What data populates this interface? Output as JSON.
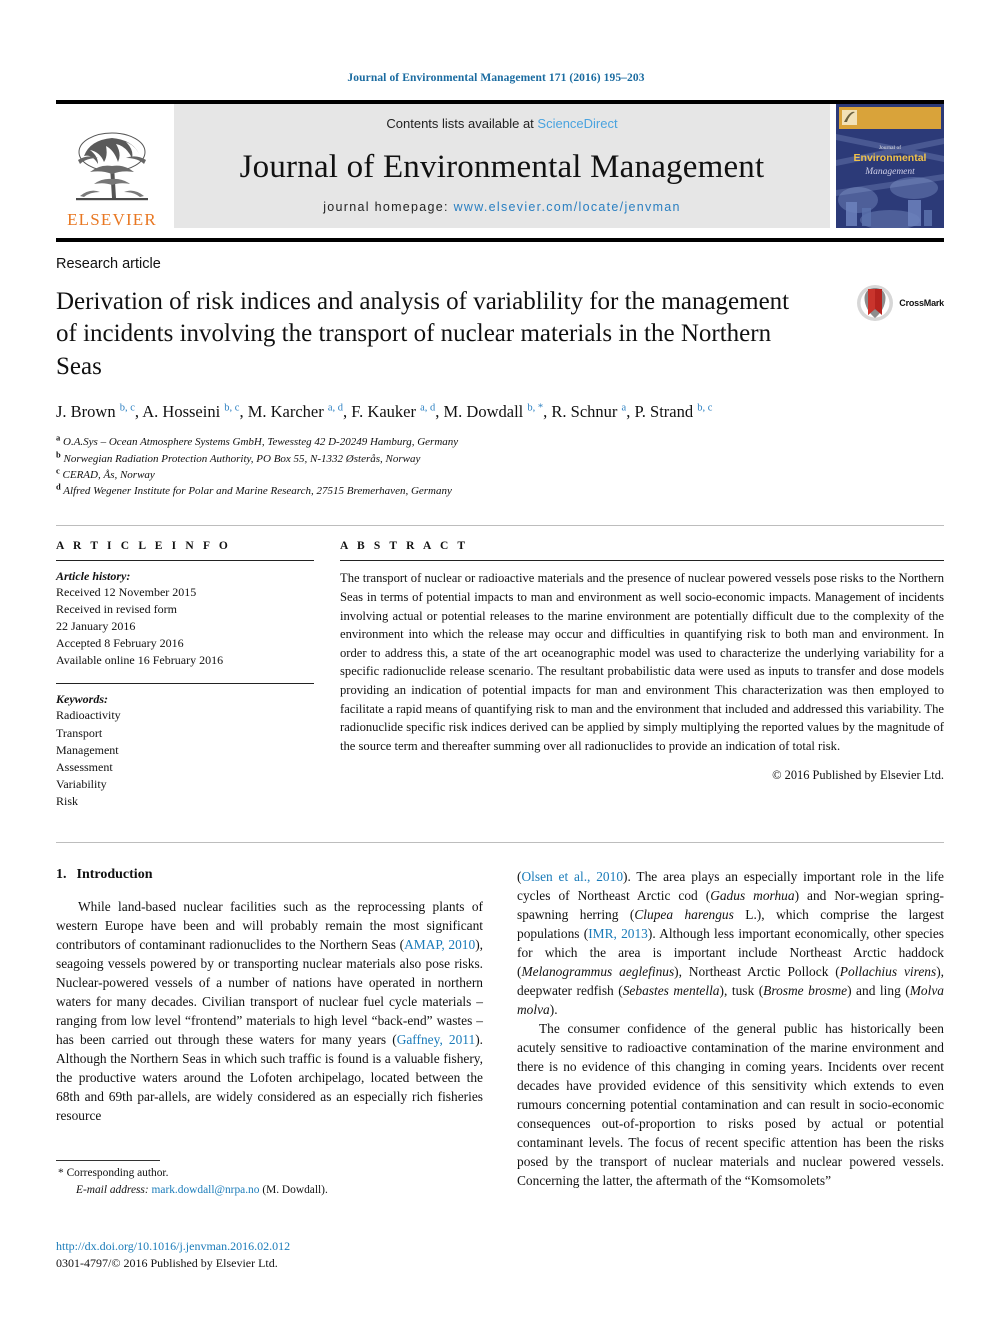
{
  "running_head": "Journal of Environmental Management 171 (2016) 195–203",
  "masthead": {
    "publisher_name": "ELSEVIER",
    "contents_prefix": "Contents lists available at ",
    "contents_link": "ScienceDirect",
    "journal_title": "Journal of Environmental Management",
    "homepage_prefix": "journal homepage: ",
    "homepage_url": "www.elsevier.com/locate/jenvman",
    "cover_label_small": "Journal of",
    "cover_label_line1": "Environmental",
    "cover_label_line2": "Management"
  },
  "article": {
    "type": "Research article",
    "title": "Derivation of risk indices and analysis of variablility for the management of incidents involving the transport of nuclear materials in the Northern Seas",
    "crossmark_label": "CrossMark",
    "authors": [
      {
        "name": "J. Brown",
        "marks": "b, c",
        "sep": ", "
      },
      {
        "name": "A. Hosseini",
        "marks": "b, c",
        "sep": ", "
      },
      {
        "name": "M. Karcher",
        "marks": "a, d",
        "sep": ", "
      },
      {
        "name": "F. Kauker",
        "marks": "a, d",
        "sep": ", "
      },
      {
        "name": "M. Dowdall",
        "marks": "b, *",
        "sep": ", "
      },
      {
        "name": "R. Schnur",
        "marks": "a",
        "sep": ", "
      },
      {
        "name": "P. Strand",
        "marks": "b, c",
        "sep": ""
      }
    ],
    "affiliations": [
      {
        "mark": "a",
        "text": "O.A.Sys – Ocean Atmosphere Systems GmbH, Tewessteg 42 D-20249 Hamburg, Germany"
      },
      {
        "mark": "b",
        "text": "Norwegian Radiation Protection Authority, PO Box 55, N-1332 Østerås, Norway"
      },
      {
        "mark": "c",
        "text": "CERAD, Ås, Norway"
      },
      {
        "mark": "d",
        "text": "Alfred Wegener Institute for Polar and Marine Research, 27515 Bremerhaven, Germany"
      }
    ]
  },
  "article_info": {
    "label": "A R T I C L E   I N F O",
    "history_head": "Article history:",
    "history_lines": [
      "Received 12 November 2015",
      "Received in revised form",
      "22 January 2016",
      "Accepted 8 February 2016",
      "Available online 16 February 2016"
    ],
    "keywords_head": "Keywords:",
    "keywords": [
      "Radioactivity",
      "Transport",
      "Management",
      "Assessment",
      "Variability",
      "Risk"
    ]
  },
  "abstract": {
    "label": "A B S T R A C T",
    "text": "The transport of nuclear or radioactive materials and the presence of nuclear powered vessels pose risks to the Northern Seas in terms of potential impacts to man and environment as well socio-economic impacts. Management of incidents involving actual or potential releases to the marine environment are potentially difficult due to the complexity of the environment into which the release may occur and difficulties in quantifying risk to both man and environment. In order to address this, a state of the art oceanographic model was used to characterize the underlying variability for a specific radionuclide release scenario. The resultant probabilistic data were used as inputs to transfer and dose models providing an indication of potential impacts for man and environment This characterization was then employed to facilitate a rapid means of quantifying risk to man and the environment that included and addressed this variability. The radionuclide specific risk indices derived can be applied by simply multiplying the reported values by the magnitude of the source term and thereafter summing over all radionuclides to provide an indication of total risk.",
    "copyright": "© 2016 Published by Elsevier Ltd."
  },
  "body": {
    "section_number": "1.",
    "section_title": "Introduction",
    "left_para_1": {
      "s1": "While land-based nuclear facilities such as the reprocessing plants of western Europe have been and will probably remain the most significant contributors of contaminant radionuclides to the Northern Seas (",
      "ref1": "AMAP, 2010",
      "s2": "), seagoing vessels powered by or transporting nuclear materials also pose risks. Nuclear-powered vessels of a number of nations have operated in northern waters for many decades. Civilian transport of nuclear fuel cycle materials – ranging from low level “frontend” materials to high level “back-end” wastes – has been carried out through these waters for many years (",
      "ref2": "Gaffney, 2011",
      "s3": "). Although the Northern Seas in which such traffic is found is a valuable fishery, the productive waters around the Lofoten archipelago, located between the 68th and 69th par-allels, are widely considered as an especially rich fisheries resource"
    },
    "right_para_1": {
      "s0": "(",
      "ref1": "Olsen et al., 2010",
      "s1": "). The area plays an especially important role in the life cycles of Northeast Arctic cod (",
      "it1": "Gadus morhua",
      "s2": ") and Nor-wegian spring-spawning herring (",
      "it2": "Clupea harengus",
      "s3": " L.), which comprise the largest populations (",
      "ref2": "IMR, 2013",
      "s4": "). Although less important economically, other species for which the area is important include Northeast Arctic haddock (",
      "it3": "Melanogrammus aeglefinus",
      "s5": "), Northeast Arctic Pollock (",
      "it4": "Pollachius virens",
      "s6": "), deepwater redfish (",
      "it5": "Sebastes mentella",
      "s7": "), tusk (",
      "it6": "Brosme brosme",
      "s8": ") and ling (",
      "it7": "Molva molva",
      "s9": ")."
    },
    "right_para_2": "The consumer confidence of the general public has historically been acutely sensitive to radioactive contamination of the marine environment and there is no evidence of this changing in coming years. Incidents over recent decades have provided evidence of this sensitivity which extends to even rumours concerning potential contamination and can result in socio-economic consequences out-of-proportion to risks posed by actual or potential contaminant levels. The focus of recent specific attention has been the risks posed by the transport of nuclear materials and nuclear powered vessels. Concerning the latter, the aftermath of the “Komsomolets”"
  },
  "footer": {
    "corresponding_marker": "*",
    "corresponding_label": "Corresponding author.",
    "email_label": "E-mail address:",
    "email": "mark.dowdall@nrpa.no",
    "email_suffix": "(M. Dowdall).",
    "doi": "http://dx.doi.org/10.1016/j.jenvman.2016.02.012",
    "issn_line": "0301-4797/© 2016 Published by Elsevier Ltd."
  },
  "colors": {
    "link_blue": "#1a7bb9",
    "header_blue": "#1a6ba0",
    "elsevier_orange": "#E87722",
    "sciencedirect_blue": "#4aa3df",
    "masthead_gray": "#e6e6e6",
    "cover_navy": "#2c3a78",
    "cover_gold": "#d9a33a",
    "crossmark_red": "#b5231e"
  }
}
